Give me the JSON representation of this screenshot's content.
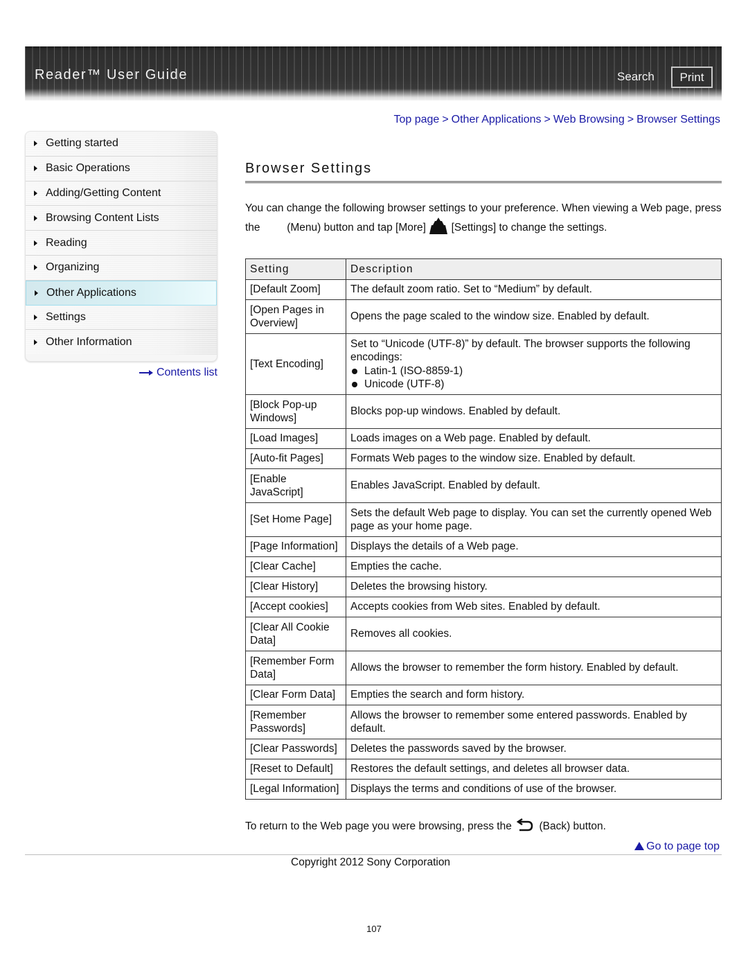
{
  "header": {
    "title": "Reader™ User Guide",
    "search_label": "Search",
    "print_label": "Print"
  },
  "breadcrumb": {
    "items": [
      "Top page",
      "Other Applications",
      "Web Browsing",
      "Browser Settings"
    ],
    "separator": ">"
  },
  "sidebar": {
    "items": [
      {
        "label": "Getting started",
        "active": false
      },
      {
        "label": "Basic Operations",
        "active": false
      },
      {
        "label": "Adding/Getting Content",
        "active": false
      },
      {
        "label": "Browsing Content Lists",
        "active": false
      },
      {
        "label": "Reading",
        "active": false
      },
      {
        "label": "Organizing",
        "active": false
      },
      {
        "label": "Other Applications",
        "active": true
      },
      {
        "label": "Settings",
        "active": false
      },
      {
        "label": "Other Information",
        "active": false
      }
    ],
    "contents_link": "Contents list"
  },
  "main": {
    "title": "Browser Settings",
    "intro": {
      "part1": "You can change the following browser settings to your preference. When viewing a Web page, press the",
      "part2": "(Menu) button and tap [More]",
      "part3": "[Settings] to change the settings."
    },
    "table": {
      "headers": [
        "Setting",
        "Description"
      ],
      "rows": [
        {
          "setting": "[Default Zoom]",
          "description": "The default zoom ratio. Set to “Medium” by default."
        },
        {
          "setting": "[Open Pages in Overview]",
          "description": "Opens the page scaled to the window size. Enabled by default."
        },
        {
          "setting": "[Text Encoding]",
          "description": "Set to “Unicode (UTF-8)” by default. The browser supports the following encodings:",
          "list": [
            "Latin-1 (ISO-8859-1)",
            "Unicode (UTF-8)"
          ]
        },
        {
          "setting": "[Block Pop-up Windows]",
          "description": "Blocks pop-up windows. Enabled by default."
        },
        {
          "setting": "[Load Images]",
          "description": "Loads images on a Web page. Enabled by default."
        },
        {
          "setting": "[Auto-fit Pages]",
          "description": "Formats Web pages to the window size. Enabled by default."
        },
        {
          "setting": "[Enable JavaScript]",
          "description": "Enables JavaScript. Enabled by default."
        },
        {
          "setting": "[Set Home Page]",
          "description": "Sets the default Web page to display. You can set the currently opened Web page as your home page."
        },
        {
          "setting": "[Page Information]",
          "description": "Displays the details of a Web page."
        },
        {
          "setting": "[Clear Cache]",
          "description": "Empties the cache."
        },
        {
          "setting": "[Clear History]",
          "description": "Deletes the browsing history."
        },
        {
          "setting": "[Accept cookies]",
          "description": "Accepts cookies from Web sites. Enabled by default."
        },
        {
          "setting": "[Clear All Cookie Data]",
          "description": "Removes all cookies."
        },
        {
          "setting": "[Remember Form Data]",
          "description": "Allows the browser to remember the form history. Enabled by default."
        },
        {
          "setting": "[Clear Form Data]",
          "description": "Empties the search and form history."
        },
        {
          "setting": "[Remember Passwords]",
          "description": "Allows the browser to remember some entered passwords. Enabled by default."
        },
        {
          "setting": "[Clear Passwords]",
          "description": "Deletes the passwords saved by the browser."
        },
        {
          "setting": "[Reset to Default]",
          "description": "Restores the default settings, and deletes all browser data."
        },
        {
          "setting": "[Legal Information]",
          "description": "Displays the terms and conditions of use of the browser."
        }
      ]
    },
    "return_text": {
      "before": "To return to the Web page you were browsing, press the",
      "after": "(Back) button."
    },
    "icons": {
      "menu": "menu-icon",
      "settings": "settings-icon",
      "back": "back-icon"
    }
  },
  "footer": {
    "go_top": "Go to page top",
    "copyright": "Copyright 2012 Sony Corporation",
    "page_number": "107"
  },
  "colors": {
    "link": "#1a1aa6",
    "header_bg": "#333333",
    "active_nav": "#d4e9ee"
  }
}
